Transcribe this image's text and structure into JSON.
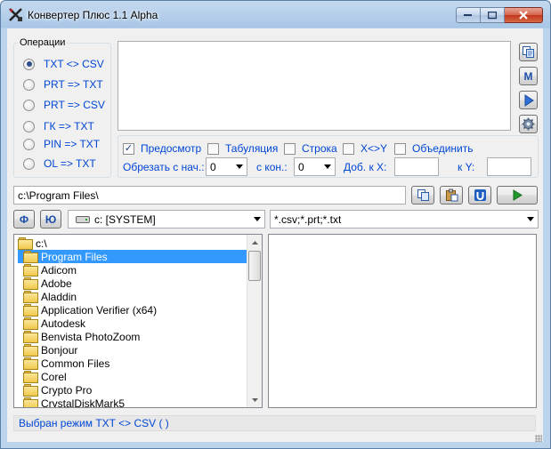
{
  "window": {
    "title": "Конвертер Плюс 1.1 Alpha"
  },
  "operations": {
    "title": "Операции",
    "items": [
      {
        "label": "TXT <> CSV",
        "selected": true
      },
      {
        "label": "PRT => TXT",
        "selected": false
      },
      {
        "label": "PRT => CSV",
        "selected": false
      },
      {
        "label": "ГК => TXT",
        "selected": false
      },
      {
        "label": "PIN => TXT",
        "selected": false
      },
      {
        "label": "OL => TXT",
        "selected": false
      }
    ]
  },
  "side_buttons": [
    {
      "icon": "copy-icon",
      "label": ""
    },
    {
      "icon": "m-letter-icon",
      "label": "M"
    },
    {
      "icon": "play-right-icon",
      "label": ""
    },
    {
      "icon": "gear-icon",
      "label": ""
    }
  ],
  "options": {
    "preview": {
      "label": "Предосмотр",
      "checked": true
    },
    "tabulation": {
      "label": "Табуляция",
      "checked": false
    },
    "row": {
      "label": "Строка",
      "checked": false
    },
    "xy": {
      "label": "X<>Y",
      "checked": false
    },
    "merge": {
      "label": "Объединить",
      "checked": false
    },
    "trim_start_label": "Обрезать с нач.:",
    "trim_start_value": "0",
    "trim_end_label": "с кон.:",
    "trim_end_value": "0",
    "add_x_label": "Доб. к X:",
    "add_x_value": "",
    "add_y_label": "к Y:",
    "add_y_value": ""
  },
  "path": {
    "value": "c:\\Program Files\\"
  },
  "drive_buttons": [
    {
      "label": "Ф"
    },
    {
      "label": "Ю"
    }
  ],
  "drive": {
    "value": "c: [SYSTEM]"
  },
  "filter": {
    "value": "*.csv;*.prt;*.txt"
  },
  "tree": {
    "root": "c:\\",
    "selected": "Program Files",
    "children": [
      "Adicom",
      "Adobe",
      "Aladdin",
      "Application Verifier (x64)",
      "Autodesk",
      "Benvista PhotoZoom",
      "Bonjour",
      "Common Files",
      "Corel",
      "Crypto Pro",
      "CrystalDiskMark5"
    ]
  },
  "status": {
    "text": "Выбран режим TXT <> CSV ( )"
  },
  "colors": {
    "accent": "#0046d5",
    "selection": "#3399ff"
  }
}
